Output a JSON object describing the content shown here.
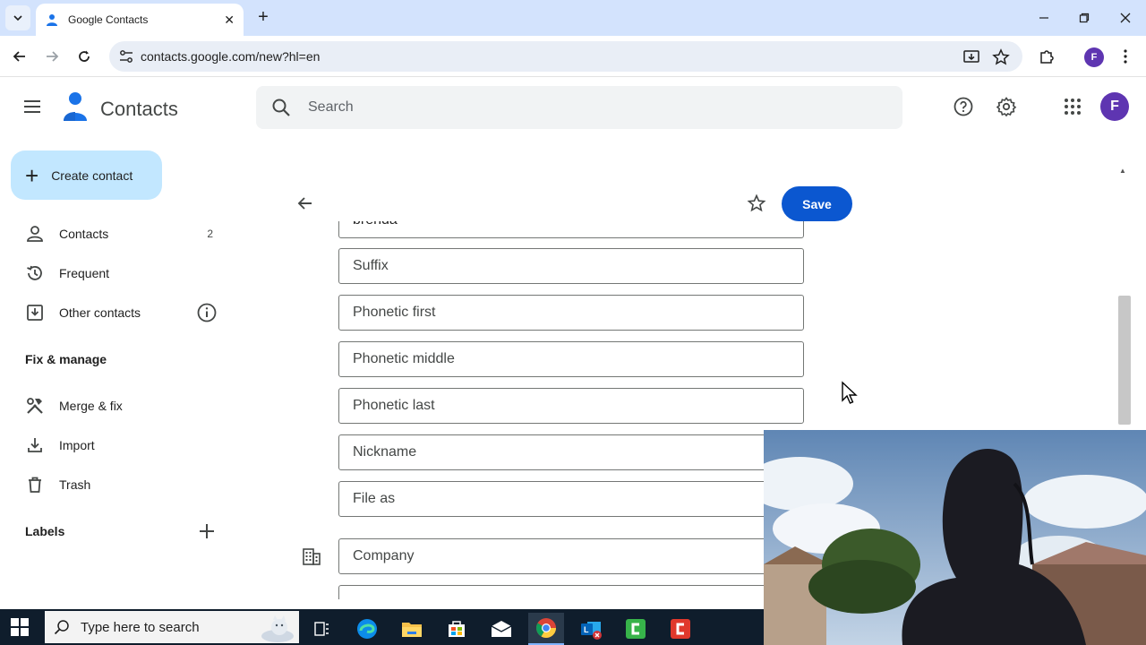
{
  "browser": {
    "tab_title": "Google Contacts",
    "url": "contacts.google.com/new?hl=en",
    "profile_initial": "F",
    "controls": [
      "minimize-icon",
      "maximize-icon",
      "close-icon"
    ]
  },
  "header": {
    "app_title": "Contacts",
    "search_placeholder": "Search",
    "avatar_initial": "F"
  },
  "sidebar": {
    "create_label": "Create contact",
    "items": [
      {
        "label": "Contacts",
        "count": "2",
        "icon": "person-icon"
      },
      {
        "label": "Frequent",
        "count": "",
        "icon": "history-icon"
      },
      {
        "label": "Other contacts",
        "count": "",
        "icon": "download-box-icon"
      }
    ],
    "fix_manage_title": "Fix & manage",
    "fix_items": [
      {
        "label": "Merge & fix",
        "icon": "tools-icon"
      },
      {
        "label": "Import",
        "icon": "import-icon"
      },
      {
        "label": "Trash",
        "icon": "trash-icon"
      }
    ],
    "labels_title": "Labels"
  },
  "form": {
    "save_label": "Save",
    "partial_top_value": "brenda",
    "fields": [
      {
        "placeholder": "Suffix"
      },
      {
        "placeholder": "Phonetic first"
      },
      {
        "placeholder": "Phonetic middle"
      },
      {
        "placeholder": "Phonetic last"
      },
      {
        "placeholder": "Nickname"
      },
      {
        "placeholder": "File as"
      },
      {
        "placeholder": "Company"
      }
    ]
  },
  "taskbar": {
    "search_placeholder": "Type here to search"
  },
  "colors": {
    "accent": "#0b57d0",
    "create_button": "#c2e7ff",
    "tabstrip": "#d3e3fd",
    "avatar": "#5e35b1"
  }
}
